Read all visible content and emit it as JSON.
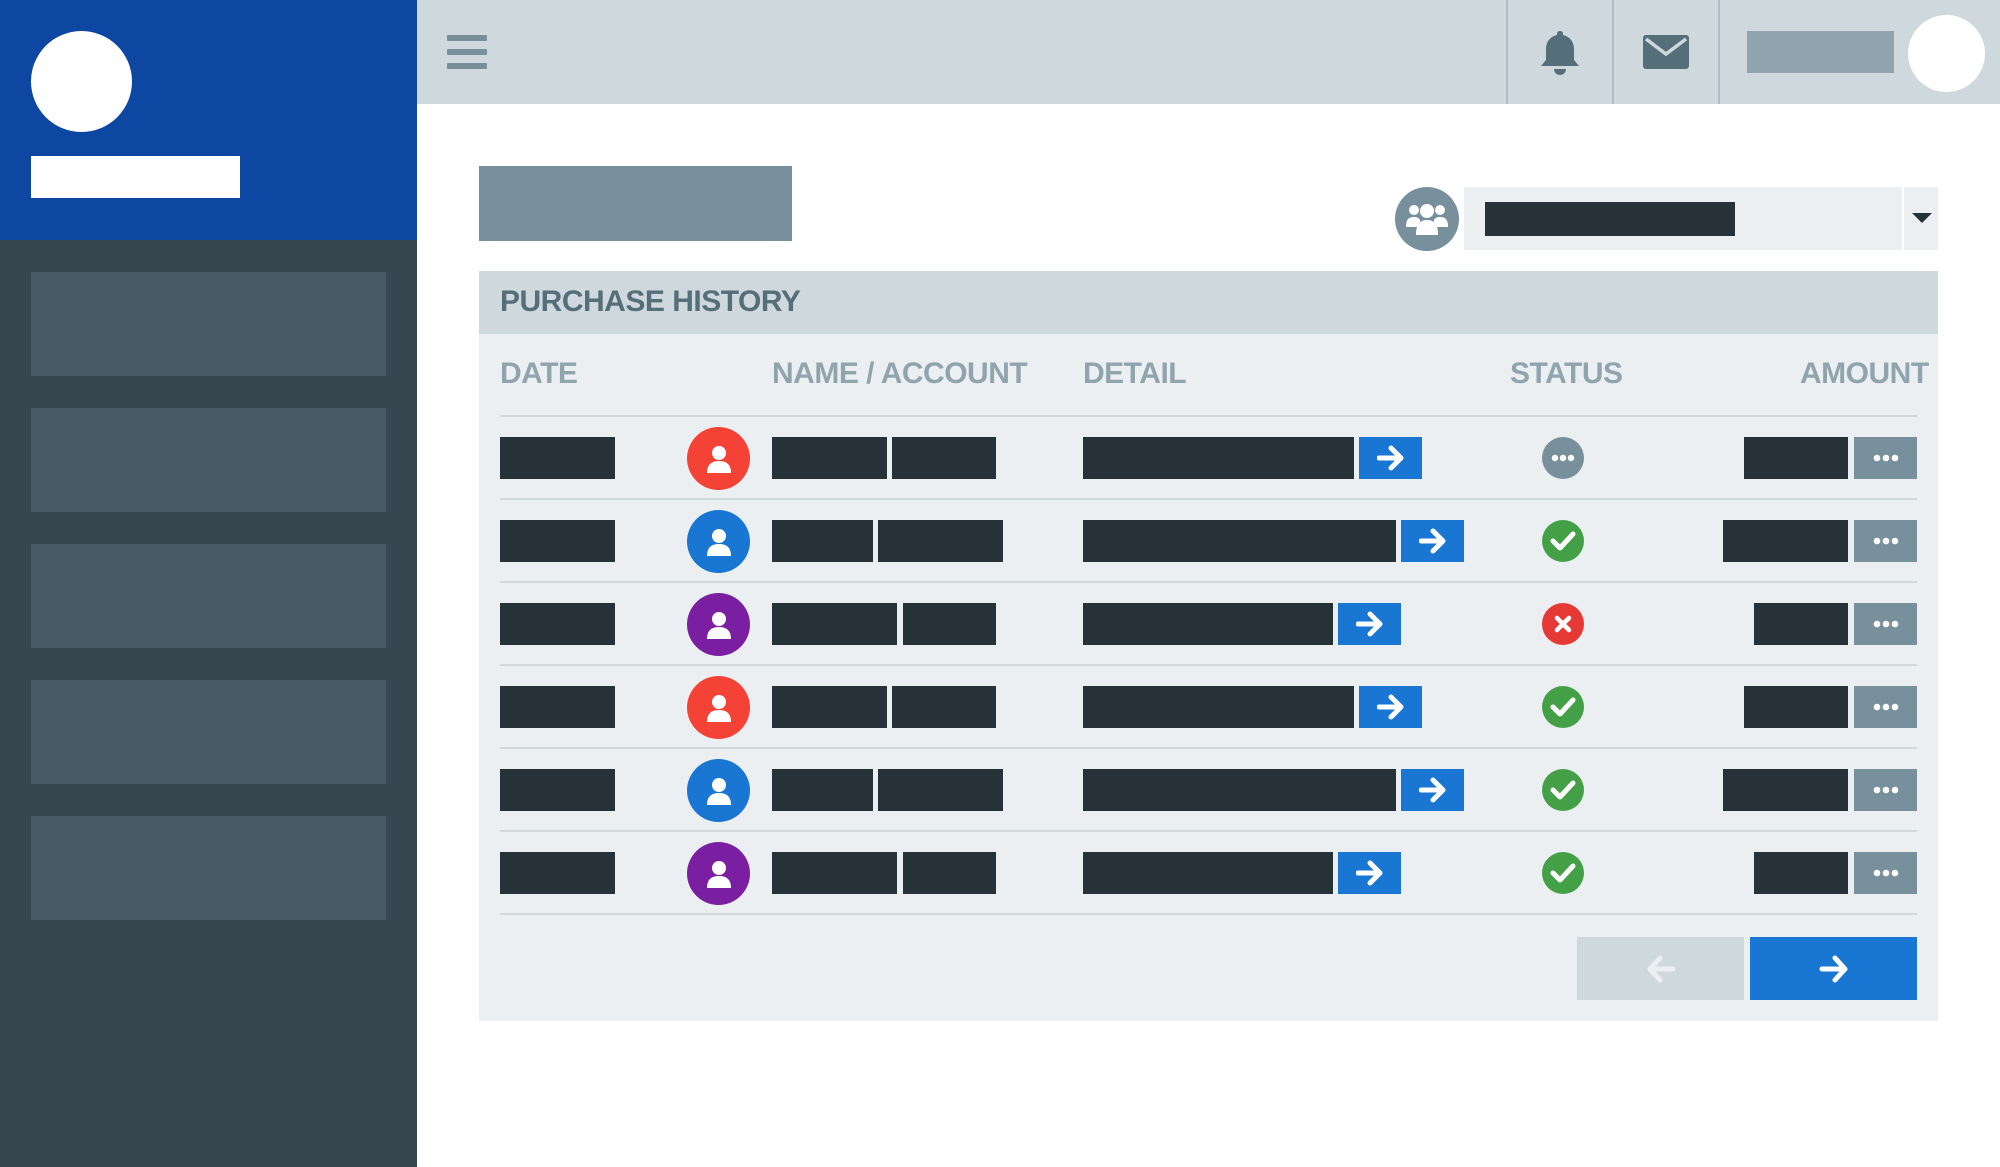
{
  "colors": {
    "sidebar_header": "#0d47a1",
    "sidebar_bg": "#37474f",
    "topbar_bg": "#cfd8dc",
    "accent_blue": "#1976d2",
    "avatar_red": "#f44336",
    "avatar_blue": "#1976d2",
    "avatar_purple": "#7b1fa2",
    "status_ok": "#43a047",
    "status_error": "#e53935",
    "status_pending": "#78909c"
  },
  "topbar": {
    "icons": [
      "menu-icon",
      "bell-icon",
      "envelope-icon"
    ]
  },
  "panel": {
    "title": "PURCHASE HISTORY",
    "columns": {
      "date": "DATE",
      "name": "NAME / ACCOUNT",
      "detail": "DETAIL",
      "status": "STATUS",
      "amount": "AMOUNT"
    }
  },
  "rows": [
    {
      "avatar_color": "red",
      "status": "pending"
    },
    {
      "avatar_color": "blue",
      "status": "ok"
    },
    {
      "avatar_color": "purple",
      "status": "error"
    },
    {
      "avatar_color": "red",
      "status": "ok"
    },
    {
      "avatar_color": "blue",
      "status": "ok"
    },
    {
      "avatar_color": "purple",
      "status": "ok"
    }
  ],
  "pager": {
    "icons": [
      "arrow-left-icon",
      "arrow-right-icon"
    ]
  }
}
